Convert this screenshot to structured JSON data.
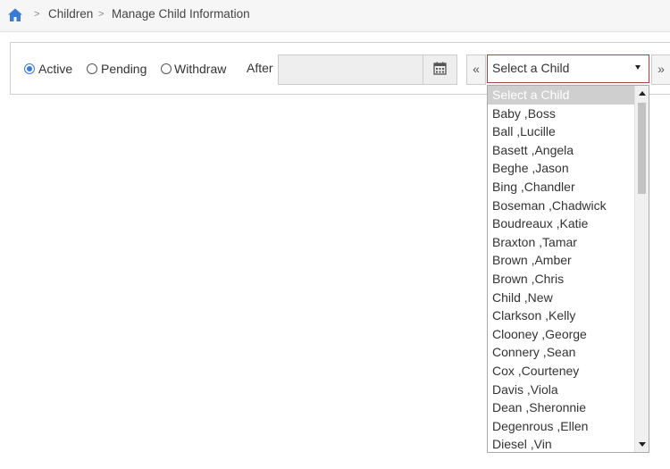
{
  "breadcrumb": {
    "home_icon": "home-icon",
    "items": [
      "Children",
      "Manage Child Information"
    ]
  },
  "filters": {
    "status_options": [
      {
        "label": "Active",
        "checked": true
      },
      {
        "label": "Pending",
        "checked": false
      },
      {
        "label": "Withdraw",
        "checked": false
      }
    ],
    "after_label": "After",
    "after_value": "",
    "calendar_icon": "calendar-icon"
  },
  "child_select": {
    "prev_label": "«",
    "next_label": "»",
    "selected": "Select a Child",
    "options": [
      "Select a Child",
      "Baby ,Boss",
      "Ball ,Lucille",
      "Basett ,Angela",
      "Beghe ,Jason",
      "Bing ,Chandler",
      "Boseman ,Chadwick",
      "Boudreaux ,Katie",
      "Braxton ,Tamar",
      "Brown ,Amber",
      "Brown ,Chris",
      "Child ,New",
      "Clarkson ,Kelly",
      "Clooney ,George",
      "Connery ,Sean",
      "Cox ,Courteney",
      "Davis ,Viola",
      "Dean ,Sheronnie",
      "Degenrous ,Ellen",
      "Diesel ,Vin"
    ]
  },
  "colors": {
    "accent": "#3b7bd6",
    "select_border": "#a94442",
    "highlight": "#cfcfcf"
  }
}
